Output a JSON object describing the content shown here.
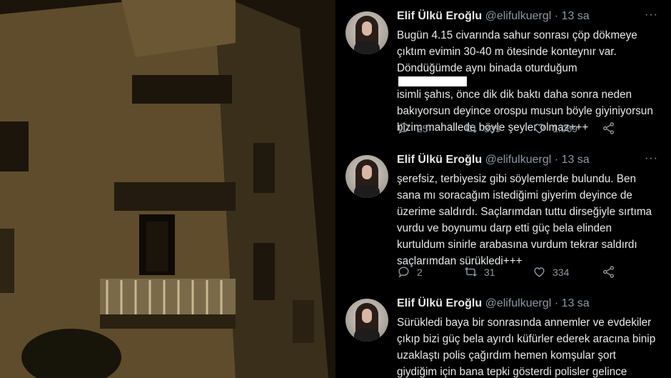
{
  "tweets": [
    {
      "name": "Elif Ülkü Eroğlu",
      "handle": "@elifulkuergl",
      "dot": "·",
      "time": "13 sa",
      "lines": [
        "Bugün 4.15 civarında sahur sonrası çöp dökmeye",
        "çıktım evimin 30-40 m ötesinde konteynır var.",
        "Döndüğümde aynı binada oturduğum",
        "isimli şahıs, önce dik dik baktı  daha sonra neden",
        "bakıyorsun deyince orospu musun böyle giyiniyorsun",
        "bizim mahallede böyle şeyler olmaz+++"
      ],
      "replies": "25",
      "retweets": "339",
      "likes": "1.069"
    },
    {
      "name": "Elif Ülkü Eroğlu",
      "handle": "@elifulkuergl",
      "dot": "·",
      "time": "13 sa",
      "lines": [
        "şerefsiz, terbiyesiz gibi söylemlerde bulundu. Ben",
        "sana mı soracağım istediğimi giyerim deyince de",
        "üzerime saldırdı. Saçlarımdan tuttu dirseğiyle sırtıma",
        "vurdu ve boynumu darp etti güç bela elinden",
        "kurtuldum sinirle arabasına vurdum tekrar saldırdı",
        "saçlarımdan sürükledi+++"
      ],
      "replies": "2",
      "retweets": "31",
      "likes": "334"
    },
    {
      "name": "Elif Ülkü Eroğlu",
      "handle": "@elifulkuergl",
      "dot": "·",
      "time": "13 sa",
      "lines": [
        "Sürükledi baya bir sonrasında annemler ve evdekiler",
        "çıkıp bizi güç bela ayırdı küfürler ederek aracına binip",
        "uzaklaştı polis çağırdım hemen komşular şort",
        "giydiğim için bana tepki gösterdi polisler gelince"
      ]
    }
  ],
  "icons": {
    "more": "more-icon",
    "reply": "reply-icon",
    "retweet": "retweet-icon",
    "like": "heart-icon",
    "share": "share-icon"
  },
  "colors": {
    "background": "#000000",
    "text": "#e7e9ea",
    "secondary": "#8b98a5"
  }
}
